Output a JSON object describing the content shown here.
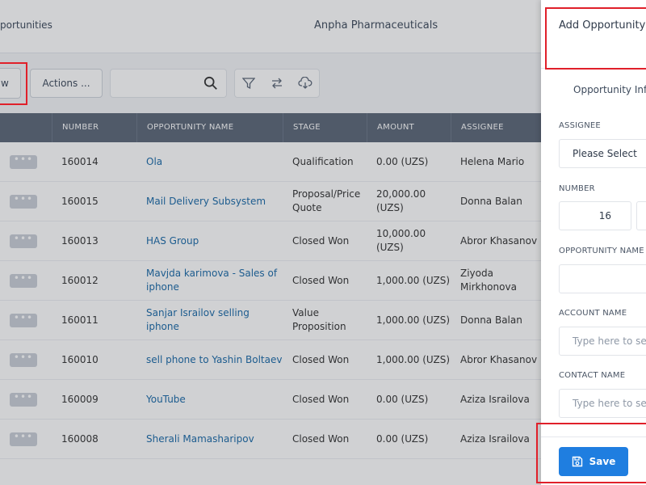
{
  "header": {
    "breadcrumb": "portunities",
    "company": "Anpha Pharmaceuticals"
  },
  "toolbar": {
    "new_label": "w",
    "actions_label": "Actions ...",
    "search_placeholder": ""
  },
  "table": {
    "columns": [
      "",
      "NUMBER",
      "OPPORTUNITY NAME",
      "STAGE",
      "AMOUNT",
      "ASSIGNEE"
    ],
    "rows": [
      {
        "number": "160014",
        "name": "Ola",
        "stage": "Qualification",
        "amount": "0.00 (UZS)",
        "assignee": "Helena Mario"
      },
      {
        "number": "160015",
        "name": "Mail Delivery Subsystem",
        "stage": "Proposal/Price Quote",
        "amount": "20,000.00 (UZS)",
        "assignee": "Donna Balan"
      },
      {
        "number": "160013",
        "name": "HAS Group",
        "stage": "Closed Won",
        "amount": "10,000.00 (UZS)",
        "assignee": "Abror Khasanov"
      },
      {
        "number": "160012",
        "name": "Mavjda karimova - Sales of iphone",
        "stage": "Closed Won",
        "amount": "1,000.00 (UZS)",
        "assignee": "Ziyoda Mirkhonova"
      },
      {
        "number": "160011",
        "name": "Sanjar Israilov selling iphone",
        "stage": "Value Proposition",
        "amount": "1,000.00 (UZS)",
        "assignee": "Donna Balan"
      },
      {
        "number": "160010",
        "name": "sell phone to Yashin Boltaev",
        "stage": "Closed Won",
        "amount": "1,000.00 (UZS)",
        "assignee": "Abror Khasanov"
      },
      {
        "number": "160009",
        "name": "YouTube",
        "stage": "Closed Won",
        "amount": "0.00 (UZS)",
        "assignee": "Aziza Israilova"
      },
      {
        "number": "160008",
        "name": "Sherali Mamasharipov",
        "stage": "Closed Won",
        "amount": "0.00 (UZS)",
        "assignee": "Aziza Israilova"
      }
    ]
  },
  "drawer": {
    "title": "Add Opportunity",
    "tab": "Opportunity Info",
    "assignee_label": "ASSIGNEE",
    "assignee_value": "Please Select",
    "number_label": "NUMBER",
    "number_value": "16",
    "name_label": "OPPORTUNITY NAME",
    "name_value": "",
    "account_label": "ACCOUNT NAME",
    "account_placeholder": "Type here to se",
    "contact_label": "CONTACT NAME",
    "contact_placeholder": "Type here to se",
    "save_label": "Save"
  },
  "colors": {
    "accent": "#1f7ee0",
    "header_bg": "#5b6778",
    "link": "#1a6aa8",
    "highlight": "#e0202a"
  }
}
